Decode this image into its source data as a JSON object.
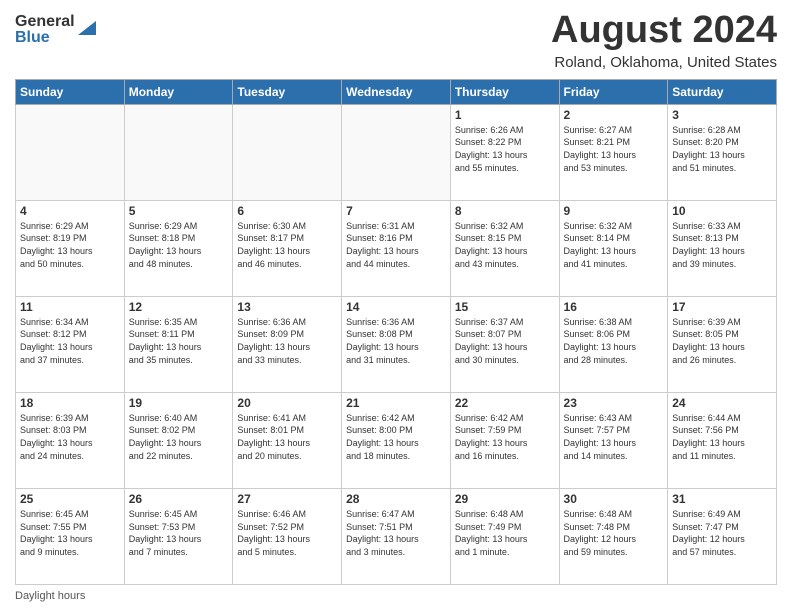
{
  "logo": {
    "general": "General",
    "blue": "Blue"
  },
  "title": "August 2024",
  "location": "Roland, Oklahoma, United States",
  "days_header": [
    "Sunday",
    "Monday",
    "Tuesday",
    "Wednesday",
    "Thursday",
    "Friday",
    "Saturday"
  ],
  "footer": "Daylight hours",
  "weeks": [
    [
      {
        "day": "",
        "info": ""
      },
      {
        "day": "",
        "info": ""
      },
      {
        "day": "",
        "info": ""
      },
      {
        "day": "",
        "info": ""
      },
      {
        "day": "1",
        "info": "Sunrise: 6:26 AM\nSunset: 8:22 PM\nDaylight: 13 hours\nand 55 minutes."
      },
      {
        "day": "2",
        "info": "Sunrise: 6:27 AM\nSunset: 8:21 PM\nDaylight: 13 hours\nand 53 minutes."
      },
      {
        "day": "3",
        "info": "Sunrise: 6:28 AM\nSunset: 8:20 PM\nDaylight: 13 hours\nand 51 minutes."
      }
    ],
    [
      {
        "day": "4",
        "info": "Sunrise: 6:29 AM\nSunset: 8:19 PM\nDaylight: 13 hours\nand 50 minutes."
      },
      {
        "day": "5",
        "info": "Sunrise: 6:29 AM\nSunset: 8:18 PM\nDaylight: 13 hours\nand 48 minutes."
      },
      {
        "day": "6",
        "info": "Sunrise: 6:30 AM\nSunset: 8:17 PM\nDaylight: 13 hours\nand 46 minutes."
      },
      {
        "day": "7",
        "info": "Sunrise: 6:31 AM\nSunset: 8:16 PM\nDaylight: 13 hours\nand 44 minutes."
      },
      {
        "day": "8",
        "info": "Sunrise: 6:32 AM\nSunset: 8:15 PM\nDaylight: 13 hours\nand 43 minutes."
      },
      {
        "day": "9",
        "info": "Sunrise: 6:32 AM\nSunset: 8:14 PM\nDaylight: 13 hours\nand 41 minutes."
      },
      {
        "day": "10",
        "info": "Sunrise: 6:33 AM\nSunset: 8:13 PM\nDaylight: 13 hours\nand 39 minutes."
      }
    ],
    [
      {
        "day": "11",
        "info": "Sunrise: 6:34 AM\nSunset: 8:12 PM\nDaylight: 13 hours\nand 37 minutes."
      },
      {
        "day": "12",
        "info": "Sunrise: 6:35 AM\nSunset: 8:11 PM\nDaylight: 13 hours\nand 35 minutes."
      },
      {
        "day": "13",
        "info": "Sunrise: 6:36 AM\nSunset: 8:09 PM\nDaylight: 13 hours\nand 33 minutes."
      },
      {
        "day": "14",
        "info": "Sunrise: 6:36 AM\nSunset: 8:08 PM\nDaylight: 13 hours\nand 31 minutes."
      },
      {
        "day": "15",
        "info": "Sunrise: 6:37 AM\nSunset: 8:07 PM\nDaylight: 13 hours\nand 30 minutes."
      },
      {
        "day": "16",
        "info": "Sunrise: 6:38 AM\nSunset: 8:06 PM\nDaylight: 13 hours\nand 28 minutes."
      },
      {
        "day": "17",
        "info": "Sunrise: 6:39 AM\nSunset: 8:05 PM\nDaylight: 13 hours\nand 26 minutes."
      }
    ],
    [
      {
        "day": "18",
        "info": "Sunrise: 6:39 AM\nSunset: 8:03 PM\nDaylight: 13 hours\nand 24 minutes."
      },
      {
        "day": "19",
        "info": "Sunrise: 6:40 AM\nSunset: 8:02 PM\nDaylight: 13 hours\nand 22 minutes."
      },
      {
        "day": "20",
        "info": "Sunrise: 6:41 AM\nSunset: 8:01 PM\nDaylight: 13 hours\nand 20 minutes."
      },
      {
        "day": "21",
        "info": "Sunrise: 6:42 AM\nSunset: 8:00 PM\nDaylight: 13 hours\nand 18 minutes."
      },
      {
        "day": "22",
        "info": "Sunrise: 6:42 AM\nSunset: 7:59 PM\nDaylight: 13 hours\nand 16 minutes."
      },
      {
        "day": "23",
        "info": "Sunrise: 6:43 AM\nSunset: 7:57 PM\nDaylight: 13 hours\nand 14 minutes."
      },
      {
        "day": "24",
        "info": "Sunrise: 6:44 AM\nSunset: 7:56 PM\nDaylight: 13 hours\nand 11 minutes."
      }
    ],
    [
      {
        "day": "25",
        "info": "Sunrise: 6:45 AM\nSunset: 7:55 PM\nDaylight: 13 hours\nand 9 minutes."
      },
      {
        "day": "26",
        "info": "Sunrise: 6:45 AM\nSunset: 7:53 PM\nDaylight: 13 hours\nand 7 minutes."
      },
      {
        "day": "27",
        "info": "Sunrise: 6:46 AM\nSunset: 7:52 PM\nDaylight: 13 hours\nand 5 minutes."
      },
      {
        "day": "28",
        "info": "Sunrise: 6:47 AM\nSunset: 7:51 PM\nDaylight: 13 hours\nand 3 minutes."
      },
      {
        "day": "29",
        "info": "Sunrise: 6:48 AM\nSunset: 7:49 PM\nDaylight: 13 hours\nand 1 minute."
      },
      {
        "day": "30",
        "info": "Sunrise: 6:48 AM\nSunset: 7:48 PM\nDaylight: 12 hours\nand 59 minutes."
      },
      {
        "day": "31",
        "info": "Sunrise: 6:49 AM\nSunset: 7:47 PM\nDaylight: 12 hours\nand 57 minutes."
      }
    ]
  ]
}
